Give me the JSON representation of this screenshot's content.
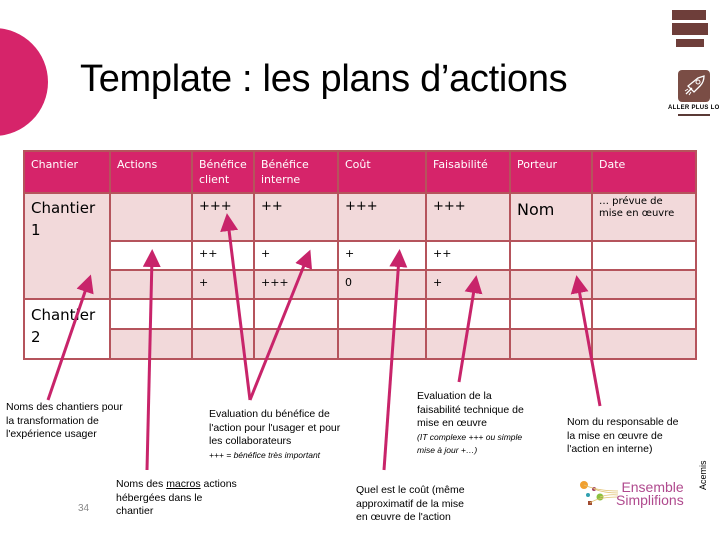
{
  "slide": {
    "title": "Template : les plans d’actions",
    "page_number": "34",
    "side_label": "Acemis",
    "badge_label": "ALLER PLUS LOIN",
    "logo_text_line1": "Ensemble",
    "logo_text_line2": "Simplifions",
    "colors": {
      "accent": "#d6246a",
      "table_border": "#b5545c",
      "table_band": "#f2d9da",
      "badge_brown": "#7a4d45"
    }
  },
  "table": {
    "headers": [
      "Chantier",
      "Actions",
      "Bénéfice client",
      "Bénéfice interne",
      "Coût",
      "Faisabilité",
      "Porteur",
      "Date"
    ],
    "chantier1": {
      "label": "Chantier 1",
      "rows": [
        {
          "actions": "",
          "benefice_client": "+++",
          "benefice_interne": "++",
          "cout": "+++",
          "faisabilite": "+++",
          "porteur": "Nom",
          "date": "… prévue de mise en œuvre"
        },
        {
          "actions": "",
          "benefice_client": "++",
          "benefice_interne": "+",
          "cout": "+",
          "faisabilite": "++",
          "porteur": "",
          "date": ""
        },
        {
          "actions": "",
          "benefice_client": "+",
          "benefice_interne": "+++",
          "cout": "0",
          "faisabilite": "+",
          "porteur": "",
          "date": ""
        }
      ]
    },
    "chantier2": {
      "label": "Chantier 2",
      "rows": [
        {
          "actions": "",
          "benefice_client": "",
          "benefice_interne": "",
          "cout": "",
          "faisabilite": "",
          "porteur": "",
          "date": ""
        },
        {
          "actions": "",
          "benefice_client": "",
          "benefice_interne": "",
          "cout": "",
          "faisabilite": "",
          "porteur": "",
          "date": ""
        }
      ]
    }
  },
  "annotations": {
    "chantiers": "Noms des chantiers pour la transformation de l'expérience usager",
    "macros_prefix": "Noms des ",
    "macros_underlined": "macros",
    "macros_suffix": " actions hébergées dans le chantier",
    "benefice_main": "Evaluation du bénéfice de l'action pour l'usager et pour les collaborateurs",
    "benefice_note": "+++ = bénéfice très important",
    "cout": "Quel est le coût (même approximatif de la mise en œuvre de l'action",
    "faisabilite_main": "Evaluation de la faisabilité technique de mise en œuvre",
    "faisabilite_note": "(IT complexe +++ ou simple mise à jour +…)",
    "porteur": "Nom du responsable de la mise en œuvre de l'action en interne)"
  }
}
